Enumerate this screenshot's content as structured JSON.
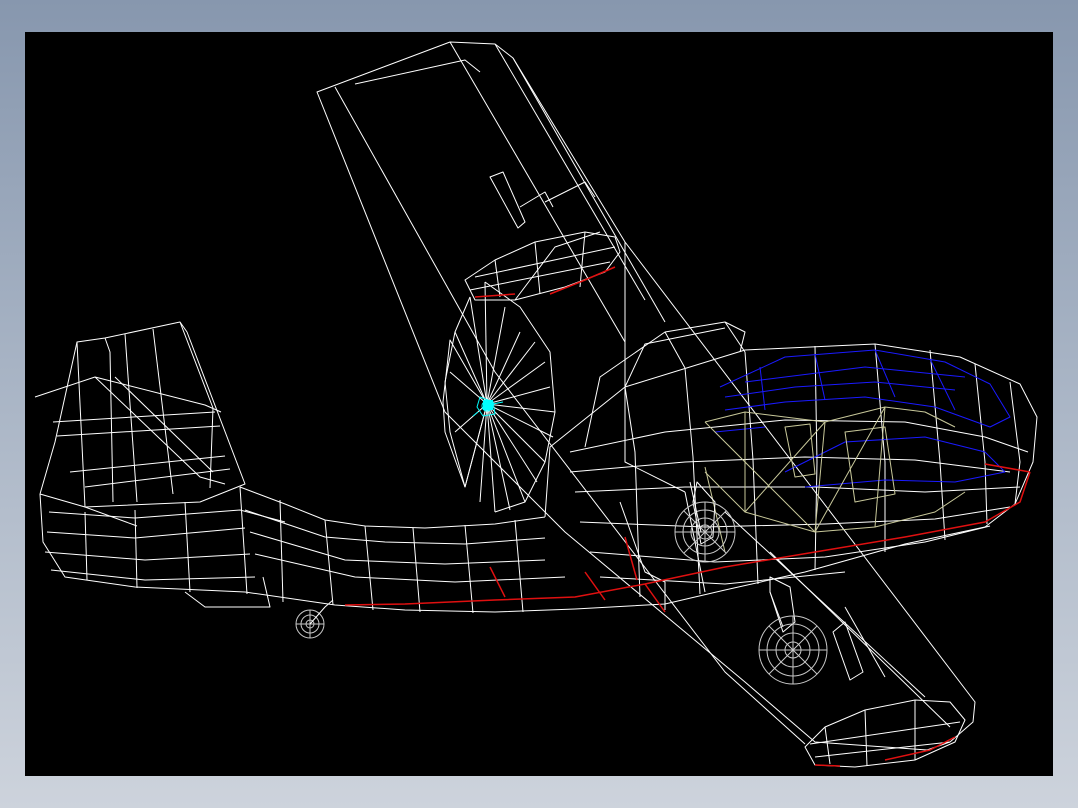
{
  "viewport": {
    "background": "#000000",
    "frame_gradient": [
      "#8797ae",
      "#cdd3dc"
    ]
  },
  "drawing": {
    "subject": "",
    "render_mode": "wireframe",
    "colors": {
      "structure": "#ffffff",
      "waterline": "#e01010",
      "canopy": "#1a1aff",
      "interior": "#c8c89a",
      "propeller_hub": "#00ffff",
      "landing_gear": "#c8c8c8"
    }
  }
}
